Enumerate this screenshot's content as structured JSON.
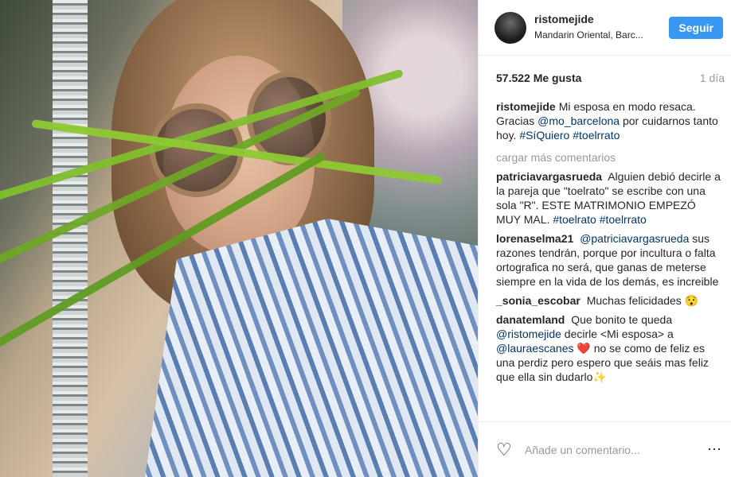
{
  "post": {
    "user": "ristomejide",
    "location": "Mandarin Oriental, Barc...",
    "follow_label": "Seguir",
    "likes": "57.522 Me gusta",
    "time": "1 día",
    "caption": {
      "user": "ristomejide",
      "text_1": "Mi esposa en modo resaca. Gracias ",
      "mention": "@mo_barcelona",
      "text_2": " por cuidarnos tanto hoy. ",
      "tags": "#SíQuiero #toelrrato"
    },
    "load_more": "cargar más comentarios"
  },
  "comments": [
    {
      "user": "patriciavargasrueda",
      "text": "Alguien debió decirle a la pareja que \"toelrato\" se escribe con una sola \"R\". ESTE MATRIMONIO EMPEZÓ MUY MAL.",
      "tags": "#toelrato #toelrrato"
    },
    {
      "user": "lorenaselma21",
      "mention": "@patriciavargasrueda",
      "text": "sus razones tendrán, porque por incultura o falta ortografica no será, que ganas de meterse siempre en la vida de los demás, es increible"
    },
    {
      "user": "_sonia_escobar",
      "text": "Muchas felicidades 😯"
    },
    {
      "user": "danatemland",
      "text_1": "Que bonito te queda",
      "mention_1": "@ristomejide",
      "text_2": "decirle <Mi esposa> a",
      "mention_2": "@lauraescanes",
      "text_3": "❤️ no se como de feliz es una perdiz pero espero que seáis mas feliz que ella sin dudarlo✨"
    }
  ],
  "add_comment_placeholder": "Añade un comentario...",
  "more_options": "⋯",
  "heart_icon": "♡"
}
